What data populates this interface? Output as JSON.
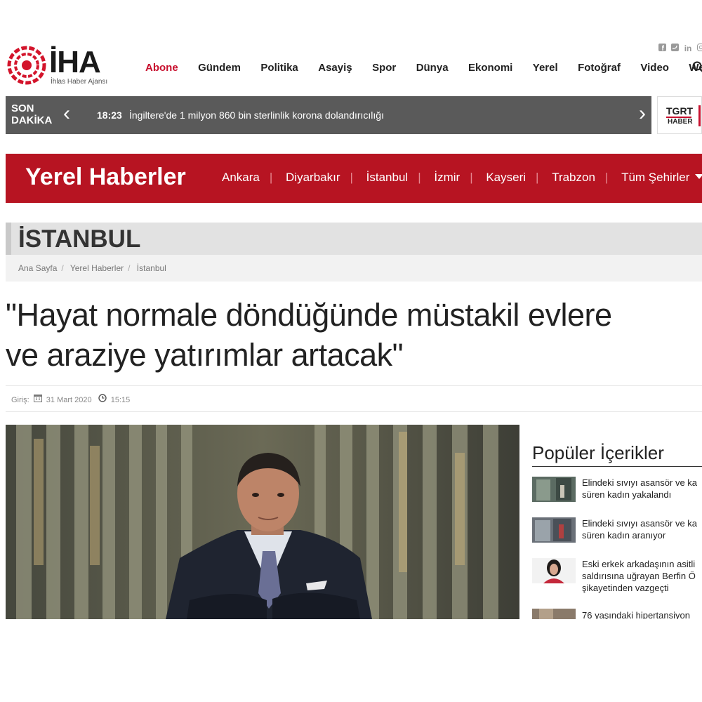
{
  "brand": {
    "name": "İHA",
    "subtitle": "İhlas Haber Ajansı"
  },
  "nav": [
    "Abone",
    "Gündem",
    "Politika",
    "Asayiş",
    "Spor",
    "Dünya",
    "Ekonomi",
    "Yerel",
    "Fotoğraf",
    "Video",
    "Web TV"
  ],
  "breaking": {
    "label_line1": "SON",
    "label_line2": "DAKİKA",
    "time": "18:23",
    "text": "İngiltere'de 1 milyon 860 bin sterlinlik korona dolandırıcılığı"
  },
  "tgrt": {
    "line1": "TGRT",
    "line2": "HABER"
  },
  "yerel": {
    "title": "Yerel Haberler",
    "cities": [
      "Ankara",
      "Diyarbakır",
      "İstanbul",
      "İzmir",
      "Kayseri",
      "Trabzon"
    ],
    "all_cities": "Tüm Şehirler"
  },
  "city": {
    "name": "İSTANBUL"
  },
  "breadcrumb": [
    "Ana Sayfa",
    "Yerel Haberler",
    "İstanbul"
  ],
  "article": {
    "headline_line1": "\"Hayat normale döndüğünde müstakil evlere",
    "headline_line2": "ve araziye yatırımlar artacak\"",
    "entry_label": "Giriş:",
    "date": "31 Mart 2020",
    "time": "15:15"
  },
  "popular": {
    "title": "Popüler İçerikler",
    "items": [
      {
        "line1": "Elindeki sıvıyı asansör ve ka",
        "line2": "süren kadın yakalandı"
      },
      {
        "line1": "Elindeki sıvıyı asansör ve ka",
        "line2": "süren kadın aranıyor"
      },
      {
        "line1": "Eski erkek arkadaşının asitli",
        "line2": "saldırısına uğrayan Berfin Ö",
        "line3": "şikayetinden vazgeçti"
      },
      {
        "line1": "76 yaşındaki hipertansiyon"
      }
    ]
  },
  "colors": {
    "brand_red": "#c8102e",
    "yerel_red": "#b71422",
    "breaking_gray": "#5a5a5a"
  }
}
